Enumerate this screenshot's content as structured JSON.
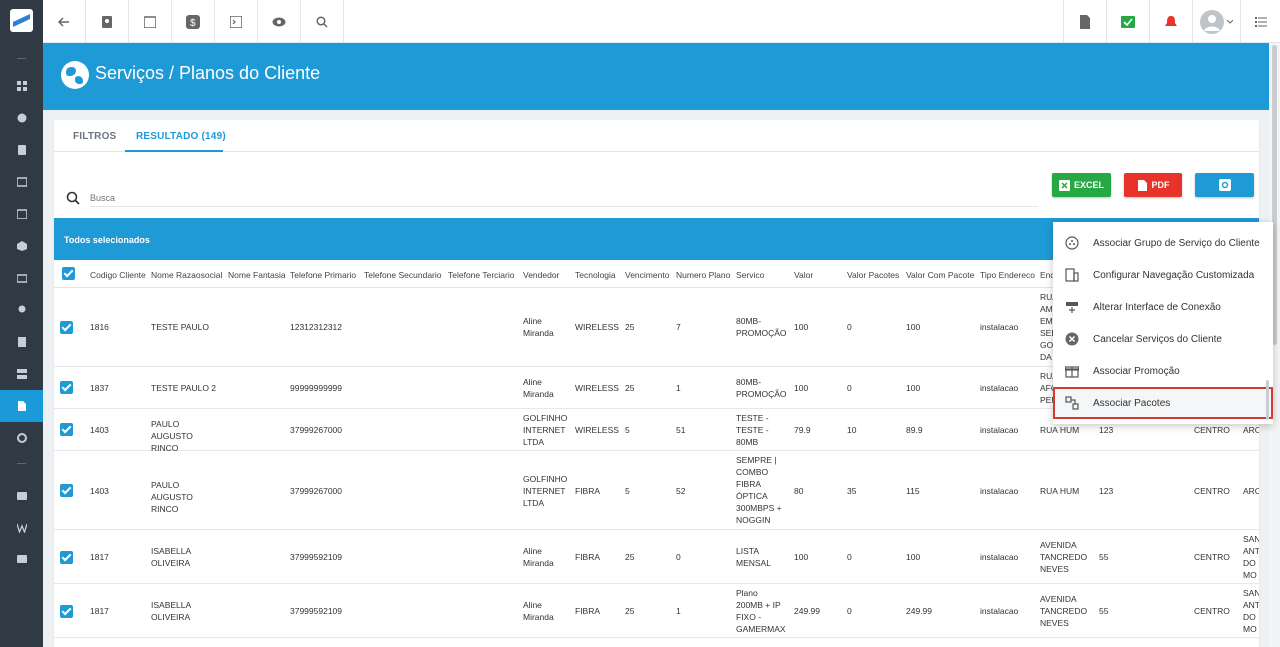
{
  "header": {
    "title": "Serviços / Planos do Cliente"
  },
  "tabs": [
    {
      "label": "FILTROS"
    },
    {
      "label": "RESULTADO (149)"
    }
  ],
  "search": {
    "placeholder": "Busca"
  },
  "buttons": {
    "excel": "EXCEL",
    "pdf": "PDF"
  },
  "selection_bar": {
    "text": "Todos selecionados"
  },
  "columns": [
    "Codigo Cliente",
    "Nome Razaosocial",
    "Nome Fantasia",
    "Telefone Primario",
    "Telefone Secundario",
    "Telefone Terciario",
    "Vendedor",
    "Tecnologia",
    "Vencimento",
    "Numero Plano",
    "Servico",
    "Valor",
    "Valor Pacotes",
    "Valor Com Pacote",
    "Tipo Endereco",
    "End"
  ],
  "rows": [
    {
      "codigo": "1816",
      "nome": "TESTE PAULO",
      "telefone": "12312312312",
      "vendedor": "Aline Miranda",
      "tecnologia": "WIRELESS",
      "vencimento": "25",
      "plano": "7",
      "servico": "80MB-PROMOÇÃO",
      "valor": "100",
      "pacotes": "0",
      "com_pacote": "100",
      "tipo": "instalacao",
      "endereco": "RUA AM EM SEB GO DA",
      "numero": "",
      "bairro": "",
      "cidade": ""
    },
    {
      "codigo": "1837",
      "nome": "TESTE PAULO 2",
      "telefone": "99999999999",
      "vendedor": "Aline Miranda",
      "tecnologia": "WIRELESS",
      "vencimento": "25",
      "plano": "1",
      "servico": "80MB-PROMOÇÃO",
      "valor": "100",
      "pacotes": "0",
      "com_pacote": "100",
      "tipo": "instalacao",
      "endereco": "RUA AFO PEN",
      "numero": "",
      "bairro": "",
      "cidade": ""
    },
    {
      "codigo": "1403",
      "nome": "PAULO AUGUSTO RINCO",
      "telefone": "37999267000",
      "vendedor": "GOLFINHO INTERNET LTDA",
      "tecnologia": "WIRELESS",
      "vencimento": "5",
      "plano": "51",
      "servico": "TESTE - TESTE - 80MB",
      "valor": "79.9",
      "pacotes": "10",
      "com_pacote": "89.9",
      "tipo": "instalacao",
      "endereco": "RUA HUM",
      "numero": "123",
      "bairro": "CENTRO",
      "cidade": "ARC"
    },
    {
      "codigo": "1403",
      "nome": "PAULO AUGUSTO RINCO",
      "telefone": "37999267000",
      "vendedor": "GOLFINHO INTERNET LTDA",
      "tecnologia": "FIBRA",
      "vencimento": "5",
      "plano": "52",
      "servico": "SEMPRE | COMBO FIBRA ÓPTICA 300MBPS + NOGGIN",
      "valor": "80",
      "pacotes": "35",
      "com_pacote": "115",
      "tipo": "instalacao",
      "endereco": "RUA HUM",
      "numero": "123",
      "bairro": "CENTRO",
      "cidade": "ARC"
    },
    {
      "codigo": "1817",
      "nome": "ISABELLA OLIVEIRA",
      "telefone": "37999592109",
      "vendedor": "Aline Miranda",
      "tecnologia": "FIBRA",
      "vencimento": "25",
      "plano": "0",
      "servico": "LISTA MENSAL",
      "valor": "100",
      "pacotes": "0",
      "com_pacote": "100",
      "tipo": "instalacao",
      "endereco": "AVENIDA TANCREDO NEVES",
      "numero": "55",
      "bairro": "CENTRO",
      "cidade": "SAN ANT DO MO"
    },
    {
      "codigo": "1817",
      "nome": "ISABELLA OLIVEIRA",
      "telefone": "37999592109",
      "vendedor": "Aline Miranda",
      "tecnologia": "FIBRA",
      "vencimento": "25",
      "plano": "1",
      "servico": "Plano 200MB + IP FIXO - GAMERMAX",
      "valor": "249.99",
      "pacotes": "0",
      "com_pacote": "249.99",
      "tipo": "instalacao",
      "endereco": "AVENIDA TANCREDO NEVES",
      "numero": "55",
      "bairro": "CENTRO",
      "cidade": "SAN ANT DO MO"
    }
  ],
  "menu": [
    {
      "label": "Associar Grupo de Serviço do Cliente",
      "icon": "group-icon"
    },
    {
      "label": "Configurar Navegação Customizada",
      "icon": "building-icon"
    },
    {
      "label": "Alterar Interface de Conexão",
      "icon": "network-icon"
    },
    {
      "label": "Cancelar Serviços do Cliente",
      "icon": "cancel-icon"
    },
    {
      "label": "Associar Promoção",
      "icon": "gift-icon"
    },
    {
      "label": "Associar Pacotes",
      "icon": "package-icon"
    }
  ],
  "colors": {
    "accent": "#1e9ad6",
    "excel": "#27a845",
    "pdf": "#e8332a",
    "sidebar": "#2f3a45",
    "highlight": "#d83a32"
  }
}
